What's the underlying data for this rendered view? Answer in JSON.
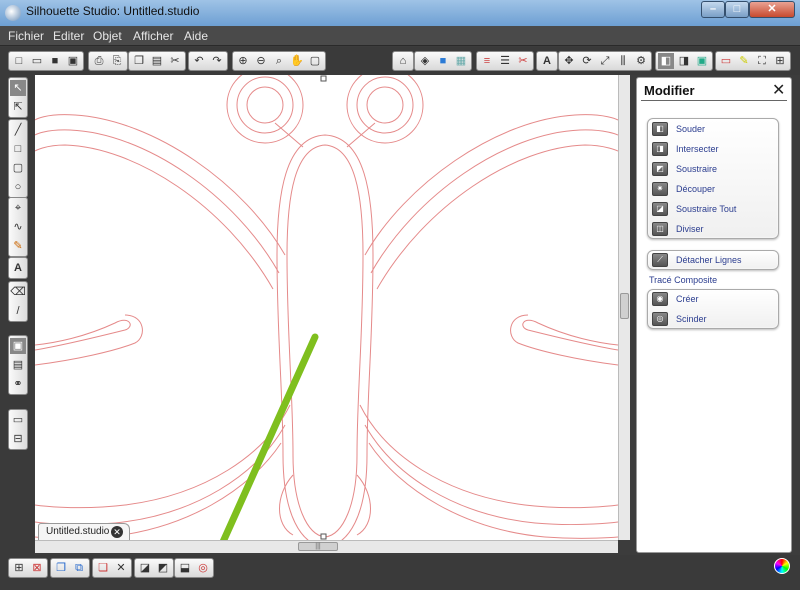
{
  "window": {
    "title": "Silhouette Studio: Untitled.studio",
    "controls": {
      "minimize": "–",
      "maximize": "□",
      "close": "✕"
    }
  },
  "menu": [
    "Fichier",
    "Editer",
    "Objet",
    "Afficher",
    "Aide"
  ],
  "document_tab": {
    "label": "Untitled.studio",
    "close": "✕"
  },
  "panel": {
    "title": "Modifier",
    "close": "✕",
    "group1": [
      "Souder",
      "Intersecter",
      "Soustraire",
      "Découper",
      "Soustraire Tout",
      "Diviser"
    ],
    "detach": "Détacher Lignes",
    "composite_label": "Tracé Composite",
    "composite": [
      "Créer",
      "Scinder"
    ]
  },
  "colors": {
    "accent_arrow": "#7fbf1e",
    "cut_line": "#e58a8a",
    "link_text": "#2b3d8f"
  },
  "icons": {
    "top_toolbar": [
      "new-icon",
      "open-icon",
      "save-icon",
      "save-as-icon",
      "print-icon",
      "print-preview-icon",
      "copy-icon",
      "paste-icon",
      "cut-icon",
      "undo-icon",
      "redo-icon",
      "zoom-in-icon",
      "zoom-out-icon",
      "zoom-area-icon",
      "pan-icon",
      "fit-page-icon",
      "lock-icon",
      "fill-icon",
      "line-color-icon",
      "pattern-icon",
      "line-style-icon",
      "line-width-icon",
      "knife-icon",
      "text-icon",
      "move-icon",
      "rotate-icon",
      "scale-icon",
      "align-icon",
      "replicate-icon",
      "modify-icon",
      "offset-icon",
      "trace-icon",
      "page-setup-icon",
      "pencil-icon",
      "fullscreen-icon",
      "grid-icon"
    ],
    "left_toolbar": [
      "select-icon",
      "point-edit-icon",
      "line-icon",
      "rectangle-icon",
      "rounded-rect-icon",
      "ellipse-icon",
      "polygon-icon",
      "curve-icon",
      "freehand-icon",
      "text-tool-icon",
      "eraser-icon",
      "knife-tool-icon",
      "page-view-icon",
      "library-icon",
      "store-icon",
      "panel-toggle-a-icon",
      "panel-toggle-b-icon"
    ],
    "bottom_toolbar": [
      "select-all-icon",
      "deselect-icon",
      "group-icon",
      "ungroup-icon",
      "duplicate-icon",
      "delete-icon",
      "bring-front-icon",
      "send-back-icon",
      "weld-icon",
      "offset-target-icon"
    ]
  }
}
